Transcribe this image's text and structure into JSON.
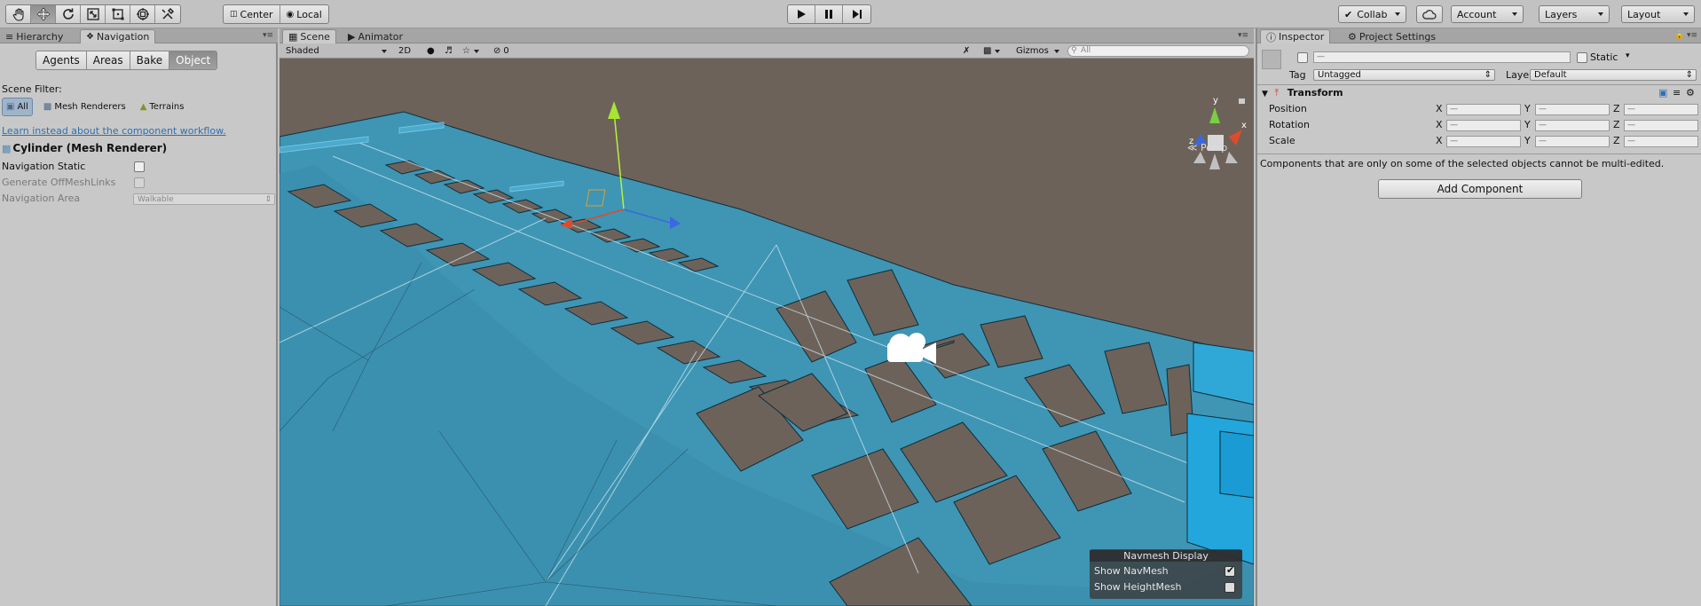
{
  "toolbar": {
    "tools": [
      "hand-tool",
      "move-tool",
      "rotate-tool",
      "scale-tool",
      "rect-tool",
      "transform-tool",
      "custom-tool"
    ],
    "pivot_label": "Center",
    "space_label": "Local",
    "collab_label": "Collab",
    "account_label": "Account",
    "layers_label": "Layers",
    "layout_label": "Layout"
  },
  "left_panel": {
    "tabs": [
      "Hierarchy",
      "Navigation"
    ],
    "nav_tabs": [
      "Agents",
      "Areas",
      "Bake",
      "Object"
    ],
    "selected_nav_tab": "Object",
    "scene_filter_label": "Scene Filter:",
    "filters": [
      "All",
      "Mesh Renderers",
      "Terrains"
    ],
    "link_text": "Learn instead about the component workflow.",
    "object_title": "Cylinder (Mesh Renderer)",
    "navigation_static_label": "Navigation Static",
    "generate_offmesh_label": "Generate OffMeshLinks",
    "navigation_area_label": "Navigation Area",
    "navigation_area_value": "Walkable"
  },
  "scene_panel": {
    "tabs": [
      "Scene",
      "Animator"
    ],
    "shading": "Shaded",
    "mode_2d": "2D",
    "hidden_count": "0",
    "gizmos_label": "Gizmos",
    "search_placeholder": "All",
    "persp_label": "Persp",
    "gizmo_axes": [
      "y",
      "x",
      "z"
    ],
    "navmesh_display": {
      "title": "Navmesh Display",
      "show_navmesh_label": "Show NavMesh",
      "show_navmesh_checked": true,
      "show_heightmesh_label": "Show HeightMesh",
      "show_heightmesh_checked": false
    },
    "colors": {
      "ground": "#6d625a",
      "navmesh": "#3f95b4"
    }
  },
  "inspector": {
    "tabs": [
      "Inspector",
      "Project Settings"
    ],
    "name_value": "—",
    "static_label": "Static",
    "tag_label": "Tag",
    "tag_value": "Untagged",
    "layer_label": "Layer",
    "layer_value": "Default",
    "transform_title": "Transform",
    "rows": [
      {
        "label": "Position",
        "x": "—",
        "y": "—",
        "z": "—"
      },
      {
        "label": "Rotation",
        "x": "—",
        "y": "—",
        "z": "—"
      },
      {
        "label": "Scale",
        "x": "—",
        "y": "—",
        "z": "—"
      }
    ],
    "axis_labels": [
      "X",
      "Y",
      "Z"
    ],
    "multi_edit_note": "Components that are only on some of the selected objects cannot be multi-edited.",
    "add_component_label": "Add Component"
  }
}
